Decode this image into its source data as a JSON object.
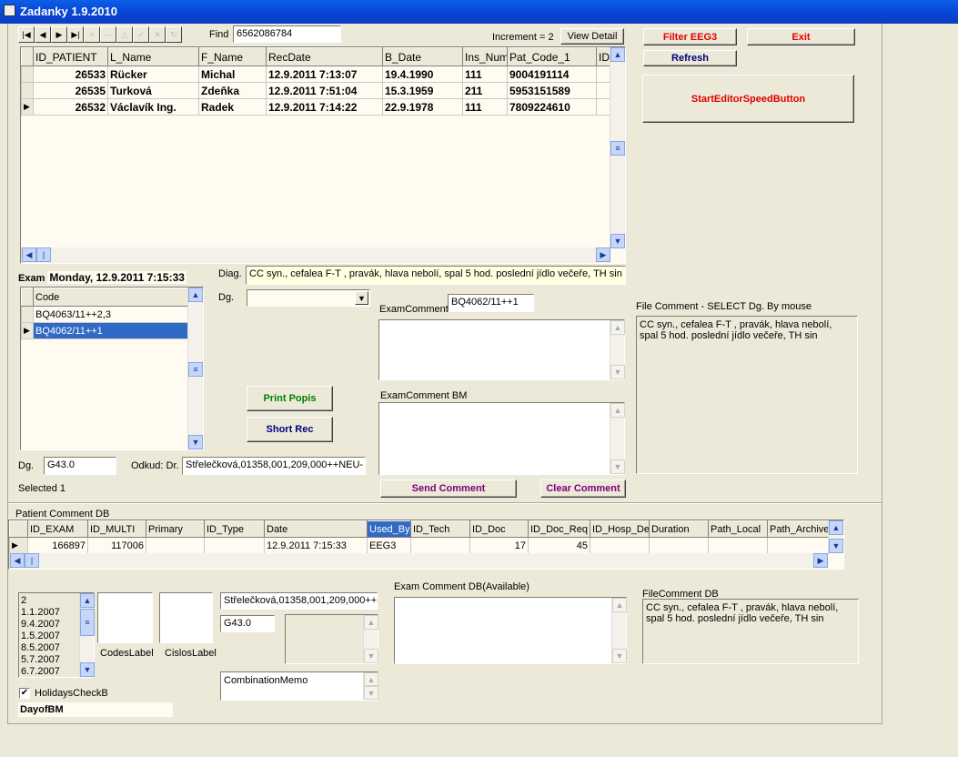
{
  "window": {
    "title": "Zadanky 1.9.2010"
  },
  "toolbar": {
    "nav_icons": [
      "first-icon",
      "prior-icon",
      "next-icon",
      "last-icon",
      "insert-icon",
      "delete-icon",
      "edit-icon",
      "post-icon",
      "cancel-icon",
      "refresh-icon"
    ],
    "find_label": "Find",
    "find_value": "6562086784",
    "increment": "Increment = 2",
    "view_detail": "View Detail"
  },
  "buttons": {
    "filter": "Filter EEG3",
    "exit": "Exit",
    "refresh": "Refresh",
    "start_editor": "StartEditorSpeedButton",
    "print_popis": "Print Popis",
    "short_rec": "Short Rec",
    "send_comment": "Send Comment",
    "clear_comment": "Clear Comment"
  },
  "colors": {
    "filter": "#e00000",
    "exit": "#e00000",
    "refresh": "#000080",
    "start_editor": "#e00000",
    "print_popis": "#008000",
    "short_rec": "#000080",
    "send_comment": "#800080",
    "clear_comment": "#800080",
    "selection": "#316ac5"
  },
  "patients": {
    "columns": [
      "ID_PATIENT",
      "L_Name",
      "F_Name",
      "RecDate",
      "B_Date",
      "Ins_Num",
      "Pat_Code_1",
      "ID"
    ],
    "rows": [
      [
        "26533",
        "Rücker",
        "Michal",
        "12.9.2011 7:13:07",
        "19.4.1990",
        "111",
        "9004191114",
        ""
      ],
      [
        "26535",
        "Turková",
        "Zdeňka",
        "12.9.2011 7:51:04",
        "15.3.1959",
        "211",
        "5953151589",
        ""
      ],
      [
        "26532",
        "Václavík Ing.",
        "Radek",
        "12.9.2011 7:14:22",
        "22.9.1978",
        "111",
        "7809224610",
        ""
      ]
    ],
    "current_row": 2
  },
  "exam": {
    "label": "Exam",
    "date": "Monday, 12.9.2011 7:15:33",
    "code_header": "Code",
    "codes": [
      "BQ4063/11++2,3",
      "BQ4062/11++1"
    ],
    "selected_index": 1,
    "diag_label": "Diag.",
    "diag_value": "CC syn., cefalea F-T , pravák, hlava nebolí, spal 5 hod. poslední jídlo večeře, TH sin",
    "dg_label": "Dg.",
    "dg_combo": "",
    "exam_comment_label": "ExamComment",
    "exam_comment_value": "BQ4062/11++1",
    "exam_comment_bm_label": "ExamComment BM",
    "file_comment_label": "File Comment - SELECT Dg. By mouse",
    "file_comment": "CC syn., cefalea F-T , pravák, hlava nebolí, spal 5 hod. poslední jídlo večeře, TH sin",
    "dg2_label": "Dg.",
    "dg2_value": "G43.0",
    "odkud_label": "Odkud: Dr.",
    "odkud_value": "Střelečková,01358,001,209,000++NEU-",
    "selected": "Selected  1"
  },
  "comments": {
    "label": "Patient Comment DB",
    "columns": [
      "ID_EXAM",
      "ID_MULTI",
      "Primary",
      "ID_Type",
      "Date",
      "Used_By",
      "ID_Tech",
      "ID_Doc",
      "ID_Doc_Req",
      "ID_Hosp_De",
      "Duration",
      "Path_Local",
      "Path_Archive"
    ],
    "rows": [
      [
        "166897",
        "117006",
        "",
        "",
        "12.9.2011 7:15:33",
        "EEG3",
        "",
        "17",
        "45",
        "",
        "",
        "",
        ""
      ]
    ],
    "highlight_column": "Used_By"
  },
  "bottom": {
    "dates": [
      "2",
      "1.1.2007",
      "9.4.2007",
      "1.5.2007",
      "8.5.2007",
      "5.7.2007",
      "6.7.2007"
    ],
    "codes_label": "CodesLabel",
    "cislos_label": "CislosLabel",
    "odkud_value": "Střelečková,01358,001,209,000++",
    "dg_value": "G43.0",
    "combination_memo": "CombinationMemo",
    "exam_comment_db_label": "Exam Comment DB(Available)",
    "file_comment_db_label": "FileComment DB",
    "file_comment_db": "CC syn., cefalea F-T , pravák, hlava nebolí, spal 5 hod. poslední jídlo večeře, TH sin",
    "holidays_label": "HolidaysCheckB",
    "holidays_checked": true,
    "day_of_bm": "DayofBM"
  }
}
